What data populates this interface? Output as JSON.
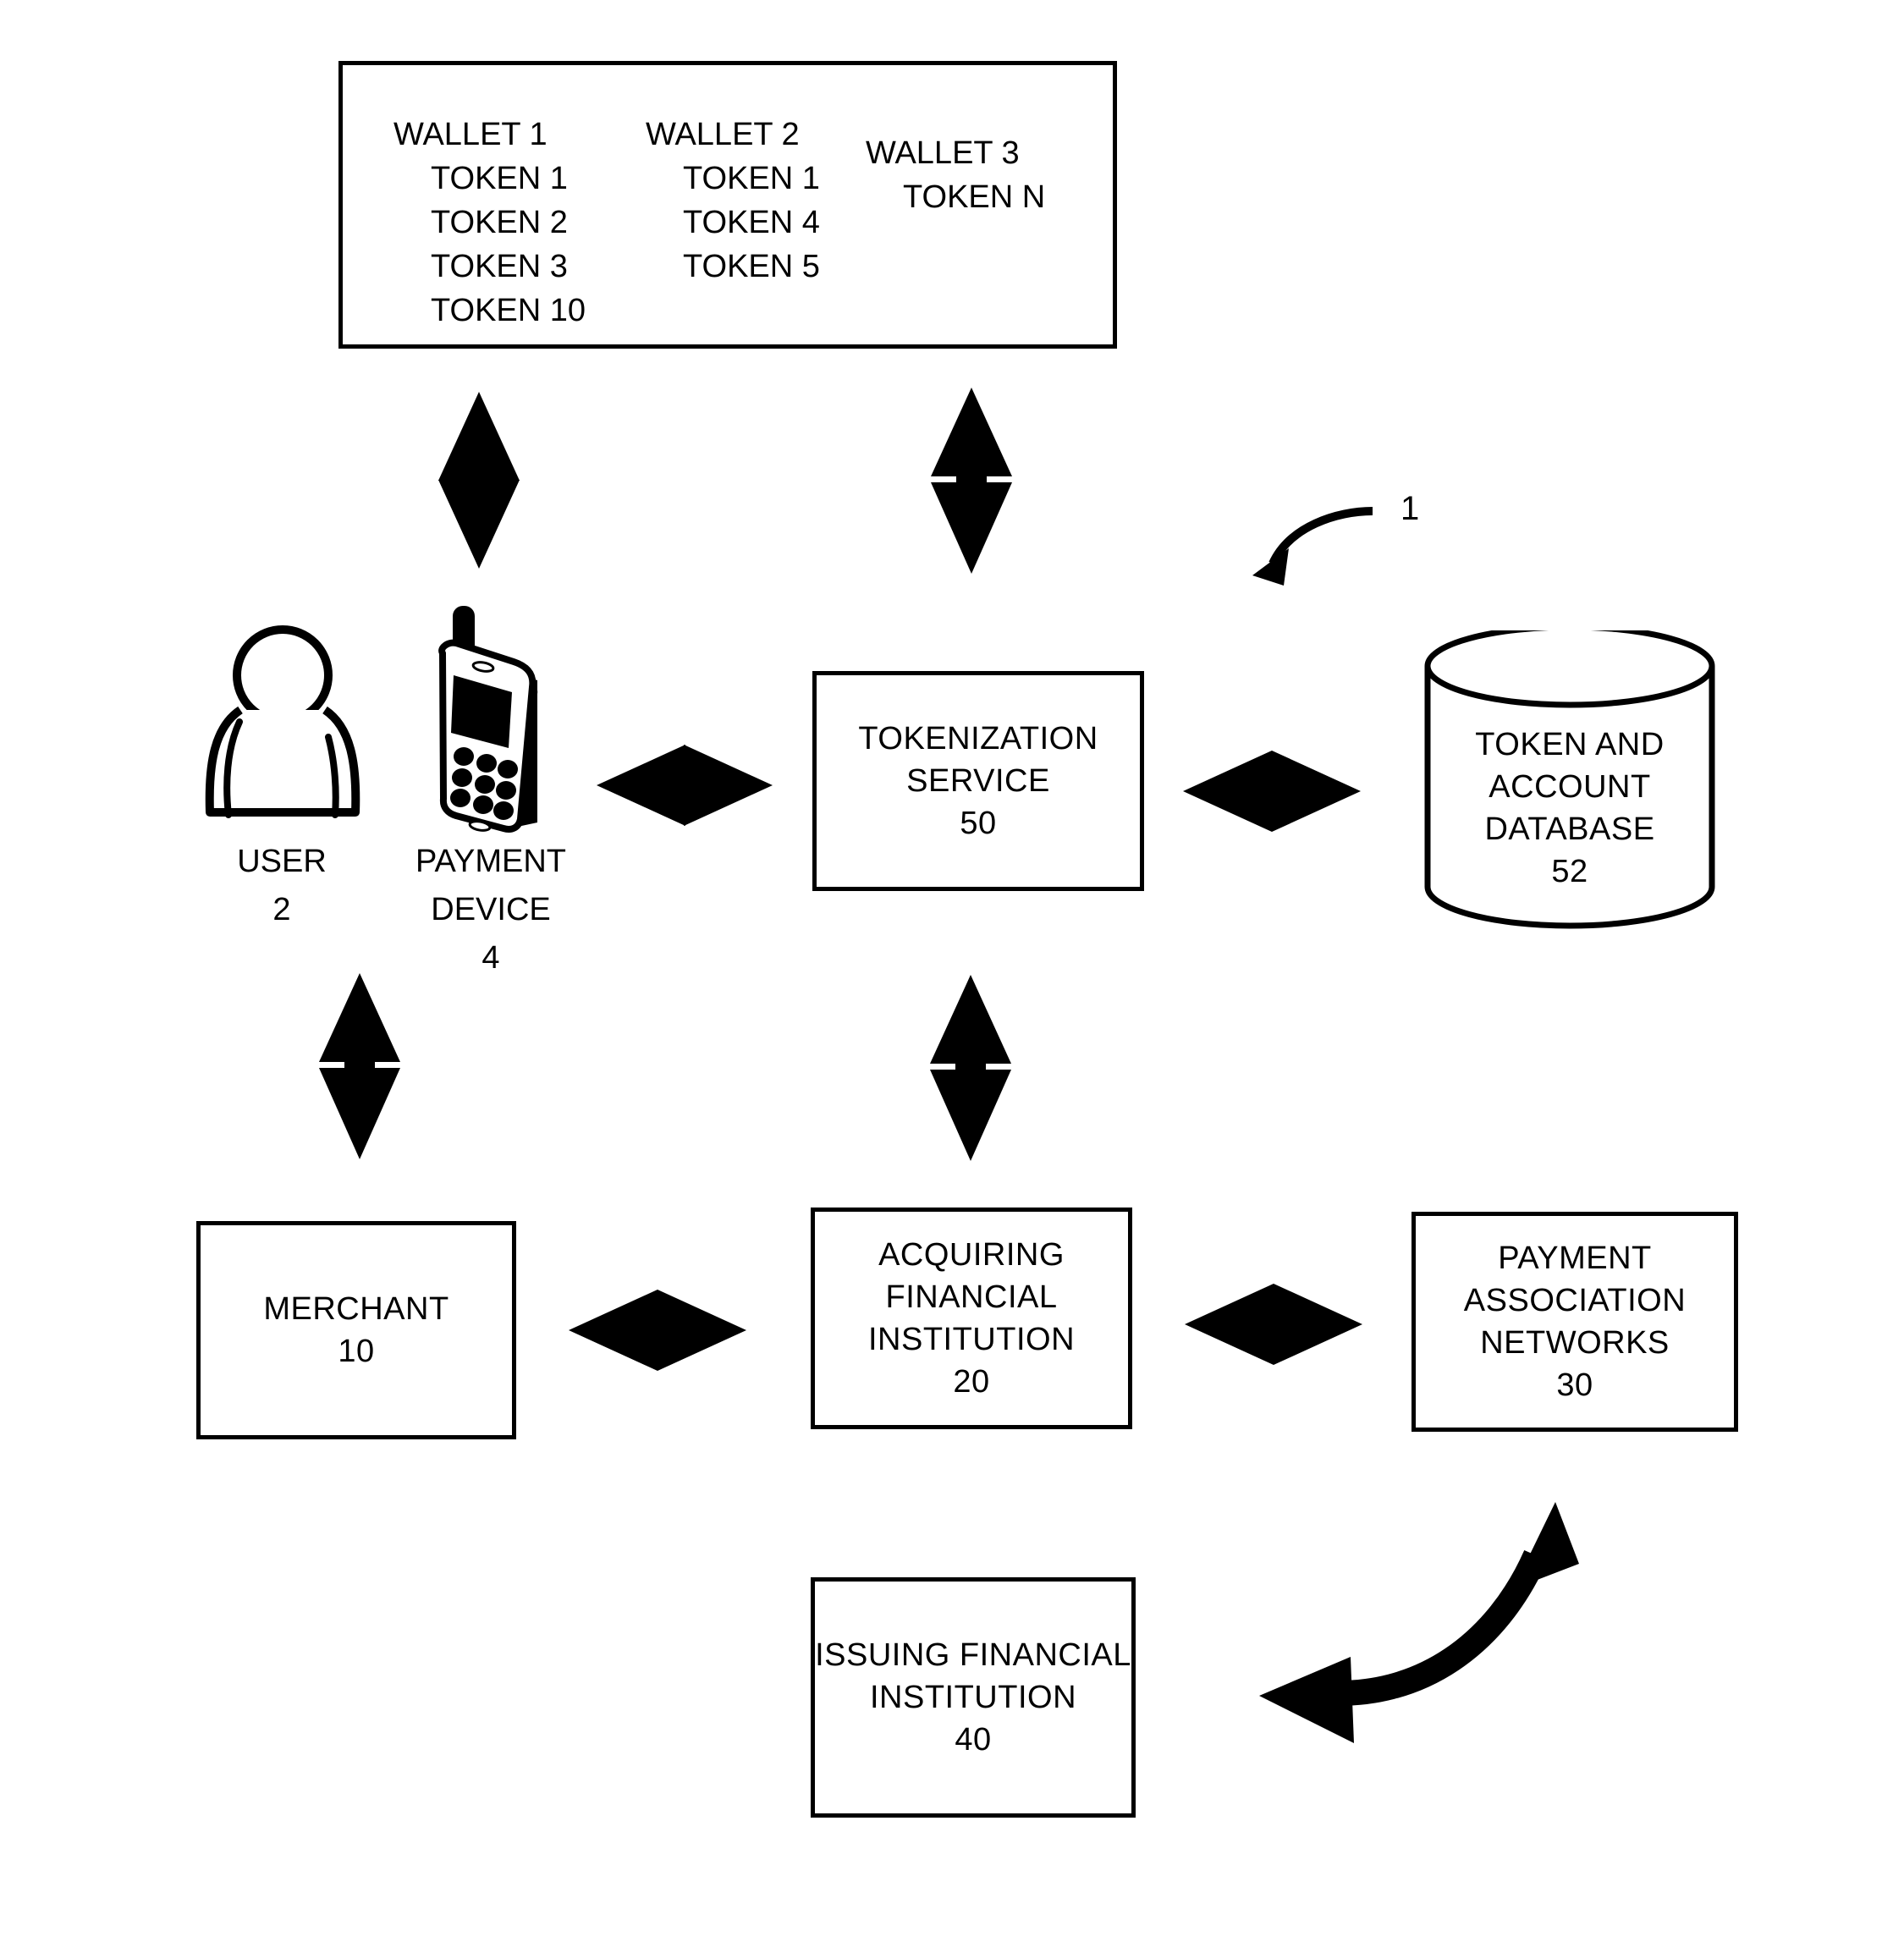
{
  "figure": {
    "reference_numeral": "1"
  },
  "wallet_container": {
    "columns": [
      {
        "title": "WALLET 1",
        "tokens": [
          "TOKEN 1",
          "TOKEN 2",
          "TOKEN 3",
          "TOKEN 10"
        ]
      },
      {
        "title": "WALLET 2",
        "tokens": [
          "TOKEN 1",
          "TOKEN 4",
          "TOKEN 5"
        ]
      },
      {
        "title": "WALLET 3",
        "tokens": [
          "TOKEN N"
        ]
      }
    ]
  },
  "actors": {
    "user": {
      "label": "USER",
      "numeral": "2"
    },
    "payment_device": {
      "label_line1": "PAYMENT",
      "label_line2": "DEVICE",
      "numeral": "4"
    }
  },
  "nodes": {
    "tokenization_service": {
      "line1": "TOKENIZATION",
      "line2": "SERVICE",
      "numeral": "50"
    },
    "token_account_database": {
      "line1": "TOKEN AND",
      "line2": "ACCOUNT",
      "line3": "DATABASE",
      "numeral": "52"
    },
    "merchant": {
      "line1": "MERCHANT",
      "numeral": "10"
    },
    "acquiring_financial_institution": {
      "line1": "ACQUIRING",
      "line2": "FINANCIAL",
      "line3": "INSTITUTION",
      "numeral": "20"
    },
    "payment_association_networks": {
      "line1": "PAYMENT",
      "line2": "ASSOCIATION",
      "line3": "NETWORKS",
      "numeral": "30"
    },
    "issuing_financial_institution": {
      "line1": "ISSUING FINANCIAL",
      "line2": "INSTITUTION",
      "numeral": "40"
    }
  },
  "colors": {
    "stroke": "#000000",
    "fill": "#ffffff"
  }
}
